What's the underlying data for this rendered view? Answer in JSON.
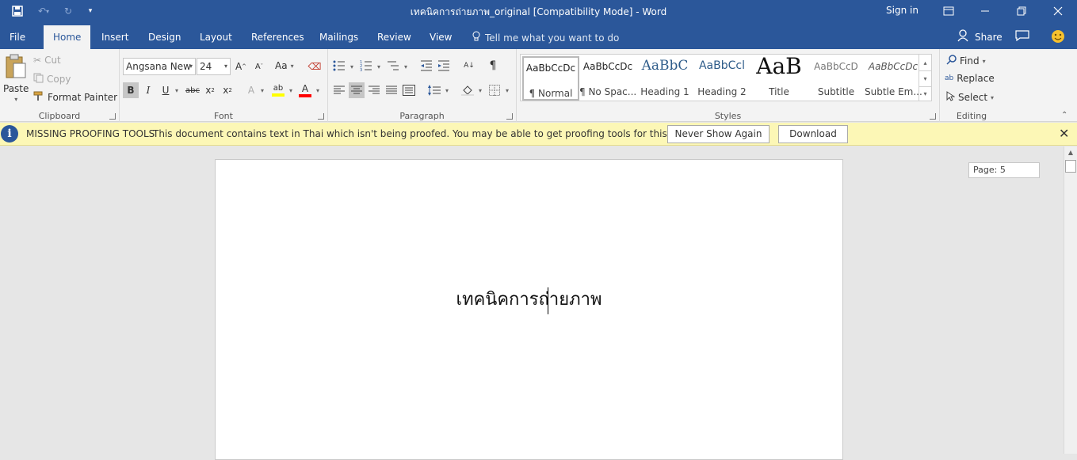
{
  "titlebar": {
    "title": "เทคนิคการถ่ายภาพ_original [Compatibility Mode]  -  Word",
    "sign_in": "Sign in"
  },
  "tabs": {
    "file": "File",
    "home": "Home",
    "insert": "Insert",
    "design": "Design",
    "layout": "Layout",
    "references": "References",
    "mailings": "Mailings",
    "review": "Review",
    "view": "View",
    "tell_me": "Tell me what you want to do",
    "share": "Share"
  },
  "clipboard": {
    "paste": "Paste",
    "cut": "Cut",
    "copy": "Copy",
    "format_painter": "Format Painter",
    "label": "Clipboard"
  },
  "font": {
    "name": "Angsana New",
    "size": "24",
    "change_case": "Aa",
    "label": "Font"
  },
  "paragraph": {
    "label": "Paragraph"
  },
  "styles": {
    "label": "Styles",
    "items": [
      {
        "sample": "AaBbCcDc",
        "name": "¶ Normal"
      },
      {
        "sample": "AaBbCcDc",
        "name": "¶ No Spac..."
      },
      {
        "sample": "AaBbC",
        "name": "Heading 1"
      },
      {
        "sample": "AaBbCcl",
        "name": "Heading 2"
      },
      {
        "sample": "AaB",
        "name": "Title"
      },
      {
        "sample": "AaBbCcD",
        "name": "Subtitle"
      },
      {
        "sample": "AaBbCcDc",
        "name": "Subtle Em..."
      }
    ]
  },
  "editing": {
    "find": "Find",
    "replace": "Replace",
    "select": "Select",
    "label": "Editing"
  },
  "message_bar": {
    "title": "MISSING PROOFING TOOLS",
    "text": "This document contains text in Thai which isn't being proofed. You may be able to get proofing tools for this language.",
    "never_show": "Never Show Again",
    "download": "Download"
  },
  "document": {
    "text": "เทคนิคการถ่ายภาพ",
    "page_indicator": "Page: 5"
  },
  "colors": {
    "accent": "#2b579a",
    "highlight": "#ffff00",
    "font_color": "#ff0000"
  }
}
